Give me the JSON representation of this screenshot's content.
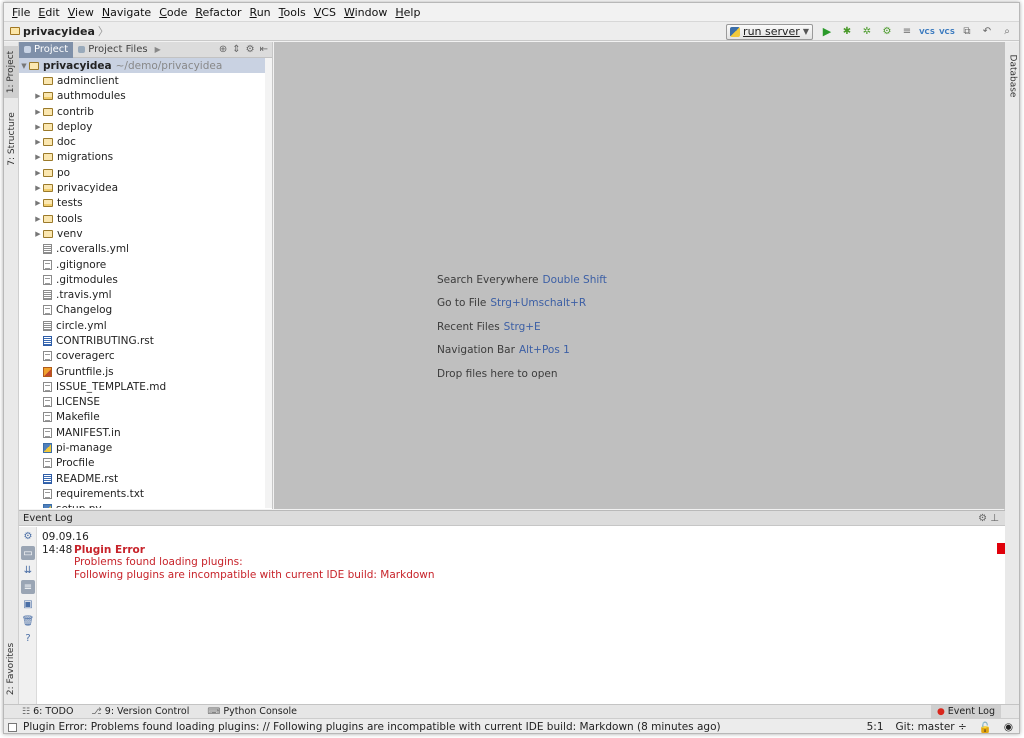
{
  "menu": [
    "File",
    "Edit",
    "View",
    "Navigate",
    "Code",
    "Refactor",
    "Run",
    "Tools",
    "VCS",
    "Window",
    "Help"
  ],
  "navbar": {
    "breadcrumb": "privacyidea",
    "run_config": "run server",
    "vcs_label": "VCS"
  },
  "left_strip": {
    "project": "1: Project",
    "structure": "7: Structure",
    "favorites": "2: Favorites"
  },
  "right_strip": {
    "database": "Database"
  },
  "project_panel": {
    "tabs": [
      "Project",
      "Project Files"
    ],
    "root": {
      "name": "privacyidea",
      "path": "~/demo/privacyidea"
    },
    "items": [
      {
        "name": "adminclient",
        "kind": "folder",
        "arrow": ""
      },
      {
        "name": "authmodules",
        "kind": "pkg",
        "arrow": "▶"
      },
      {
        "name": "contrib",
        "kind": "folder",
        "arrow": "▶"
      },
      {
        "name": "deploy",
        "kind": "folder",
        "arrow": "▶"
      },
      {
        "name": "doc",
        "kind": "folder",
        "arrow": "▶"
      },
      {
        "name": "migrations",
        "kind": "folder",
        "arrow": "▶"
      },
      {
        "name": "po",
        "kind": "folder",
        "arrow": "▶"
      },
      {
        "name": "privacyidea",
        "kind": "pkg",
        "arrow": "▶"
      },
      {
        "name": "tests",
        "kind": "pkg",
        "arrow": "▶"
      },
      {
        "name": "tools",
        "kind": "folder",
        "arrow": "▶"
      },
      {
        "name": "venv",
        "kind": "folder",
        "arrow": "▶"
      },
      {
        "name": ".coveralls.yml",
        "kind": "yml",
        "arrow": ""
      },
      {
        "name": ".gitignore",
        "kind": "text",
        "arrow": ""
      },
      {
        "name": ".gitmodules",
        "kind": "text",
        "arrow": ""
      },
      {
        "name": ".travis.yml",
        "kind": "yml",
        "arrow": ""
      },
      {
        "name": "Changelog",
        "kind": "text",
        "arrow": ""
      },
      {
        "name": "circle.yml",
        "kind": "yml",
        "arrow": ""
      },
      {
        "name": "CONTRIBUTING.rst",
        "kind": "rst",
        "arrow": ""
      },
      {
        "name": "coveragerc",
        "kind": "text",
        "arrow": ""
      },
      {
        "name": "Gruntfile.js",
        "kind": "js",
        "arrow": ""
      },
      {
        "name": "ISSUE_TEMPLATE.md",
        "kind": "text",
        "arrow": ""
      },
      {
        "name": "LICENSE",
        "kind": "text",
        "arrow": ""
      },
      {
        "name": "Makefile",
        "kind": "text",
        "arrow": ""
      },
      {
        "name": "MANIFEST.in",
        "kind": "text",
        "arrow": ""
      },
      {
        "name": "pi-manage",
        "kind": "py",
        "arrow": ""
      },
      {
        "name": "Procfile",
        "kind": "text",
        "arrow": ""
      },
      {
        "name": "README.rst",
        "kind": "rst",
        "arrow": ""
      },
      {
        "name": "requirements.txt",
        "kind": "text",
        "arrow": ""
      },
      {
        "name": "setup.py",
        "kind": "py",
        "arrow": ""
      }
    ]
  },
  "editor_hints": [
    {
      "label": "Search Everywhere",
      "key": "Double Shift"
    },
    {
      "label": "Go to File",
      "key": "Strg+Umschalt+R"
    },
    {
      "label": "Recent Files",
      "key": "Strg+E"
    },
    {
      "label": "Navigation Bar",
      "key": "Alt+Pos 1"
    },
    {
      "label": "Drop files here to open",
      "key": ""
    }
  ],
  "event_log": {
    "title": "Event Log",
    "date": "09.09.16",
    "time": "14:48",
    "entry_title": "Plugin Error",
    "line1": "Problems found loading plugins:",
    "line2": "Following plugins are incompatible with current IDE build: Markdown"
  },
  "bottom_tabs": {
    "todo": "6: TODO",
    "vcs": "9: Version Control",
    "python": "Python Console",
    "event_log": "Event Log"
  },
  "status": {
    "message": "Plugin Error: Problems found loading plugins: // Following plugins are incompatible with current IDE build: Markdown (8 minutes ago)",
    "position": "5:1",
    "git": "Git: master ÷"
  }
}
